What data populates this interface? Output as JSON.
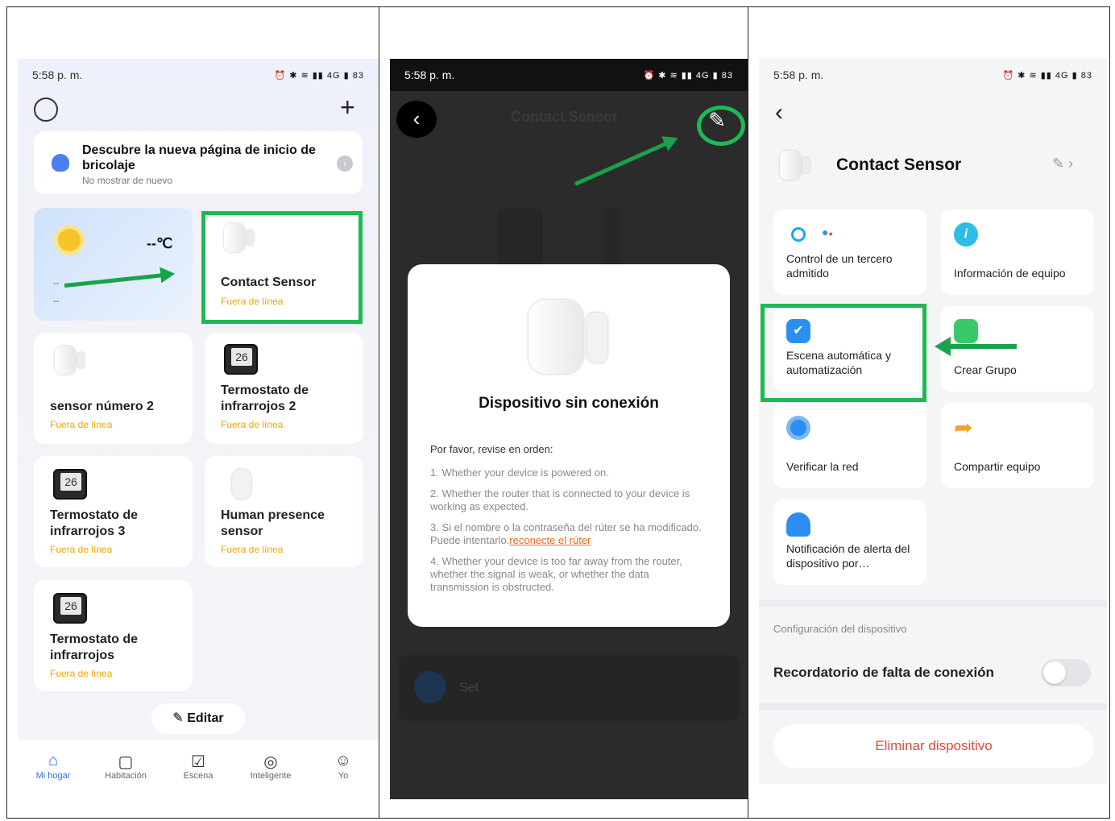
{
  "status": {
    "time": "5:58 p. m.",
    "icons": "⏰ ✱ ≋ ▮▮ 4G ▮ 83"
  },
  "home": {
    "banner_title": "Descubre la nueva página de inicio de bricolaje",
    "banner_sub": "No mostrar de nuevo",
    "weather_temp": "--℃",
    "weather_l1": "--",
    "weather_l2": "--",
    "devices": [
      {
        "name": "Contact Sensor",
        "status": "Fuera de línea"
      },
      {
        "name": "sensor número 2",
        "status": "Fuera de línea"
      },
      {
        "name": "Termostato de infrarrojos 2",
        "status": "Fuera de línea"
      },
      {
        "name": "Termostato de infrarrojos 3",
        "status": "Fuera de línea"
      },
      {
        "name": "Human presence sensor",
        "status": "Fuera de línea"
      },
      {
        "name": "Termostato de infrarrojos",
        "status": "Fuera de línea"
      }
    ],
    "edit_label": "Editar",
    "tabs": [
      "Mi hogar",
      "Habitación",
      "Escena",
      "Inteligente",
      "Yo"
    ]
  },
  "dialog": {
    "bg_title": "Contact Sensor",
    "bg_set": "Set",
    "title": "Dispositivo sin conexión",
    "intro": "Por favor, revise en orden:",
    "item1": "1. Whether your device is powered on.",
    "item2": "2. Whether the router that is connected to your device is working as expected.",
    "item3": "3. Si el nombre o la contraseña del rúter se ha modificado. Puede intentarlo.",
    "item3_link": "reconecte el rúter",
    "item4": "4. Whether your device is too far away from the router, whether the signal is weak, or whether the data transmission is obstructed."
  },
  "settings": {
    "device_name": "Contact Sensor",
    "tiles": [
      "Control de un tercero admitido",
      "Información de equipo",
      "Escena automática y automatización",
      "Crear Grupo",
      "Verificar la red",
      "Compartir equipo",
      "Notificación de alerta del dispositivo por…"
    ],
    "section": "Configuración del dispositivo",
    "reminder": "Recordatorio de falta de conexión",
    "delete": "Eliminar dispositivo"
  }
}
